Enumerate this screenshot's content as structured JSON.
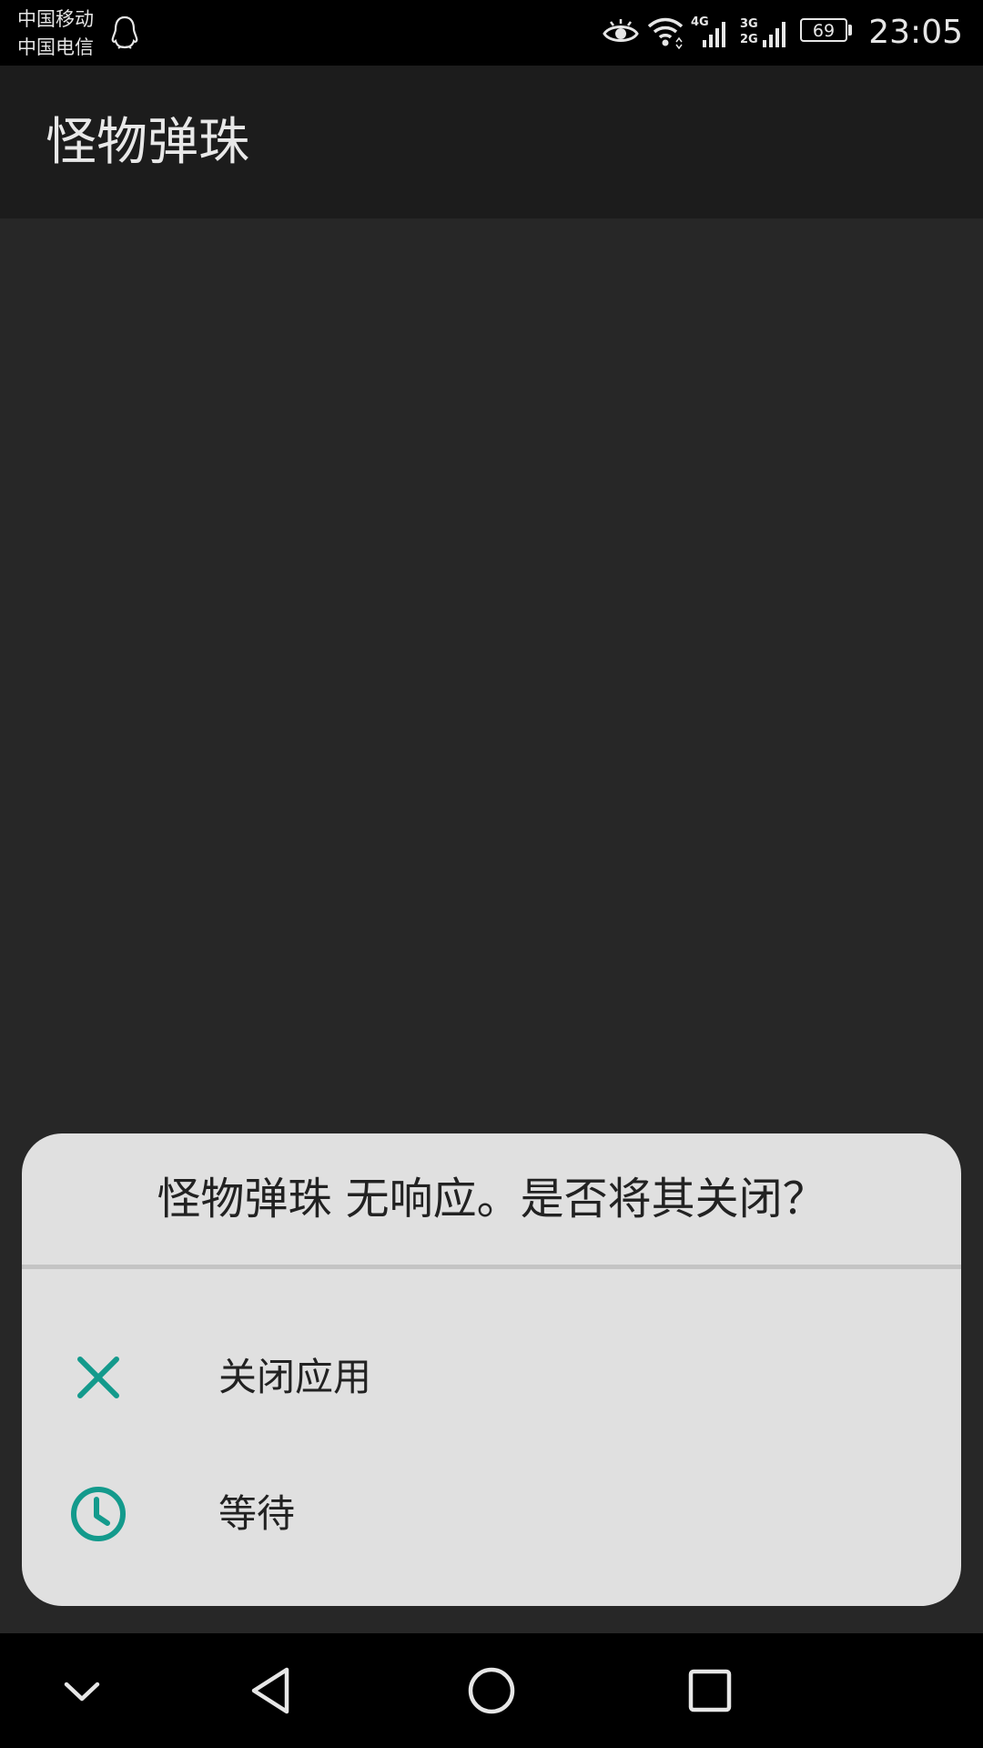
{
  "status_bar": {
    "carrier_1": "中国移动",
    "carrier_2": "中国电信",
    "notification_icon": "qq-penguin-icon",
    "icons": [
      "eye-comfort-icon",
      "wifi-icon",
      "signal-4g-icon",
      "signal-3g-2g-icon"
    ],
    "signal_1_label": "4G",
    "signal_2_label_top": "3G",
    "signal_2_label_bottom": "2G",
    "battery_level": "69",
    "time": "23:05"
  },
  "app_bar": {
    "title": "怪物弹珠"
  },
  "dialog": {
    "message": "怪物弹珠 无响应。是否将其关闭？",
    "accent_color": "#139a8c",
    "options": [
      {
        "label": "关闭应用",
        "icon": "close-icon"
      },
      {
        "label": "等待",
        "icon": "clock-icon"
      }
    ]
  },
  "nav_bar": {
    "buttons": [
      "collapse-chevron-icon",
      "back-icon",
      "home-icon",
      "recents-icon"
    ]
  }
}
